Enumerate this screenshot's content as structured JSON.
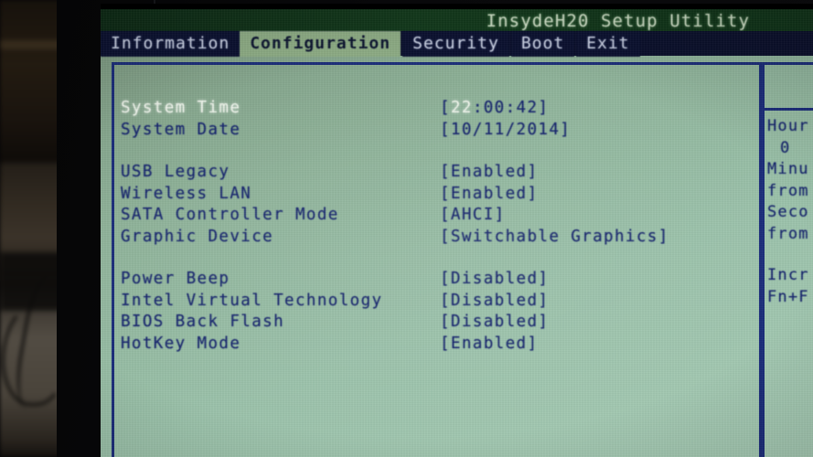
{
  "app": {
    "title": "InsydeH20 Setup Utility"
  },
  "menu": {
    "items": [
      {
        "label": "Information",
        "selected": false
      },
      {
        "label": "Configuration",
        "selected": true
      },
      {
        "label": "Security",
        "selected": false
      },
      {
        "label": "Boot",
        "selected": false
      },
      {
        "label": "Exit",
        "selected": false
      }
    ]
  },
  "settings": {
    "rows": [
      {
        "label": "System Time",
        "value": "[22:00:42]",
        "value_highlight": "22",
        "selected": true
      },
      {
        "label": "System Date",
        "value": "[10/11/2014]",
        "selected": false
      },
      {
        "label": "USB Legacy",
        "value": "[Enabled]",
        "selected": false
      },
      {
        "label": "Wireless LAN",
        "value": "[Enabled]",
        "selected": false
      },
      {
        "label": "SATA Controller Mode",
        "value": "[AHCI]",
        "selected": false
      },
      {
        "label": "Graphic Device",
        "value": "[Switchable Graphics]",
        "selected": false
      },
      {
        "label": "Power Beep",
        "value": "[Disabled]",
        "selected": false
      },
      {
        "label": "Intel Virtual Technology",
        "value": "[Disabled]",
        "selected": false
      },
      {
        "label": "BIOS Back Flash",
        "value": "[Disabled]",
        "selected": false
      },
      {
        "label": "HotKey Mode",
        "value": "[Enabled]",
        "selected": false
      }
    ]
  },
  "help": {
    "lines": [
      {
        "text": "Hour",
        "indent": false
      },
      {
        "text": "0",
        "indent": true
      },
      {
        "text": "Minu",
        "indent": false
      },
      {
        "text": "from",
        "indent": false
      },
      {
        "text": "Seco",
        "indent": false
      },
      {
        "text": "from",
        "indent": false
      }
    ],
    "lines2": [
      {
        "text": "Incr",
        "indent": false
      },
      {
        "text": "Fn+F",
        "indent": false
      }
    ]
  },
  "colors": {
    "screen_bg": "#9cc3ab",
    "text_blue": "#15246e",
    "text_white": "#f2f7ee",
    "menubar_bg": "#0a0f2c",
    "titlebar_bg": "#123a1c",
    "selected_tab_bg": "#8fae86",
    "frame_border": "#1a2c7a"
  }
}
